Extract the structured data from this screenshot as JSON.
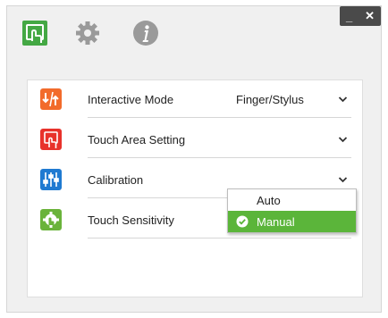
{
  "toolbar": {
    "icons": [
      "touch-icon",
      "gear-icon",
      "info-icon"
    ],
    "window_controls": {
      "minimize": "_",
      "close": "✕"
    }
  },
  "settings": {
    "rows": [
      {
        "label": "Interactive Mode",
        "value": "Finger/Stylus",
        "icon": "interactive-mode-icon",
        "icon_color": "#f26b2b"
      },
      {
        "label": "Touch Area Setting",
        "value": "",
        "icon": "touch-area-icon",
        "icon_color": "#e8322b"
      },
      {
        "label": "Calibration",
        "value": "",
        "icon": "calibration-icon",
        "icon_color": "#1f7ad1"
      },
      {
        "label": "Touch Sensitivity",
        "value": "",
        "icon": "touch-sensitivity-icon",
        "icon_color": "#6ab33a"
      }
    ]
  },
  "calibration_dropdown": {
    "options": [
      "Auto",
      "Manual"
    ],
    "selected": "Manual"
  },
  "colors": {
    "accent_green": "#5bb53a",
    "toolbar_green": "#44a844",
    "toolbar_gray": "#9a9a9a",
    "window_bg": "#f0f0f0"
  }
}
